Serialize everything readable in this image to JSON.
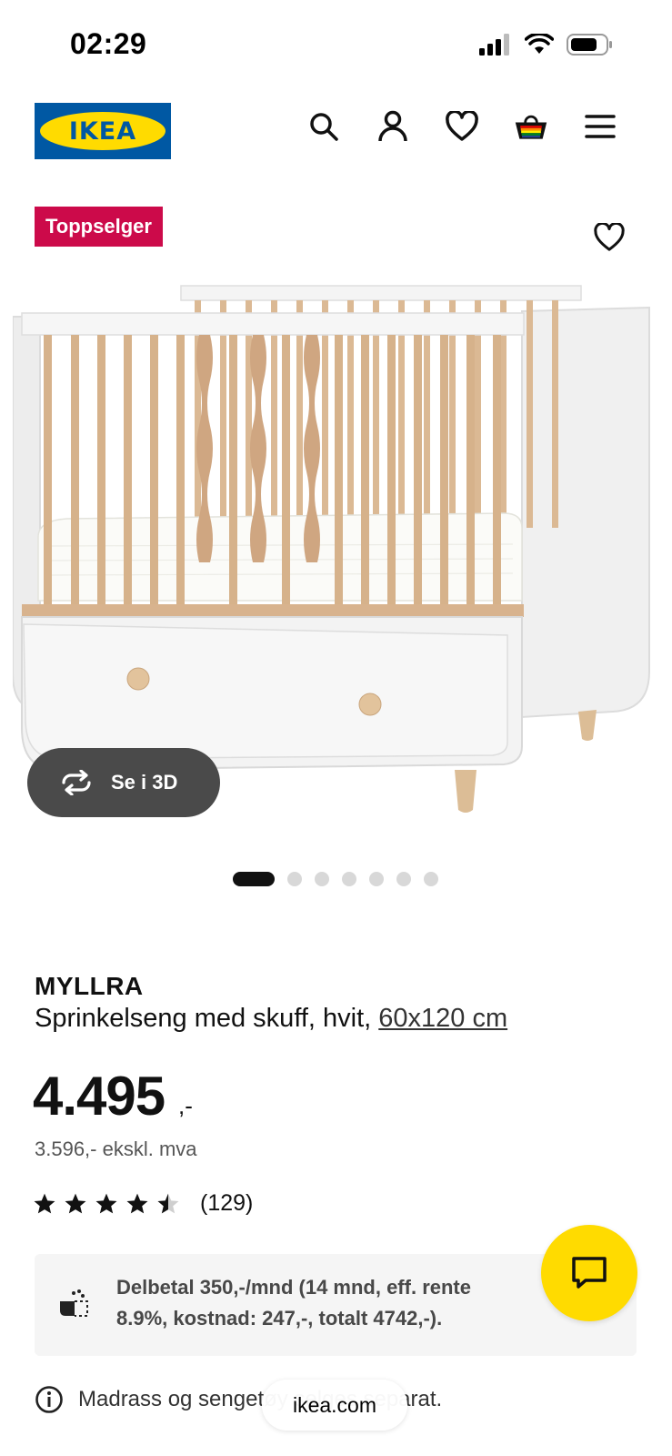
{
  "status_bar": {
    "time": "02:29"
  },
  "header": {
    "logo_text": "IKEA",
    "icons": [
      "search-icon",
      "account-icon",
      "heart-icon",
      "cart-icon",
      "menu-icon"
    ]
  },
  "gallery": {
    "badge": "Toppselger",
    "view_3d_label": "Se i 3D",
    "total_images": 7,
    "active_image": 1
  },
  "product": {
    "name": "MYLLRA",
    "description": "Sprinkelseng med skuff, hvit, ",
    "size_link": "60x120 cm",
    "price": "4.495",
    "price_suffix": ",-",
    "price_ex_vat": "3.596,- ekskl. mva",
    "rating": 4.5,
    "rating_count": "(129)"
  },
  "installment": {
    "text": "Delbetal 350,-/mnd (14 mnd, eff. rente 8.9%, kostnad: 247,-, totalt 4742,-)."
  },
  "info_note": {
    "text": "Madrass og sengetøy selges separat."
  },
  "browser": {
    "url": "ikea.com"
  },
  "colors": {
    "ikea_blue": "#0058a3",
    "ikea_yellow": "#ffdb00",
    "badge_red": "#cc0a4a",
    "dark_button": "#4a4a4a"
  }
}
